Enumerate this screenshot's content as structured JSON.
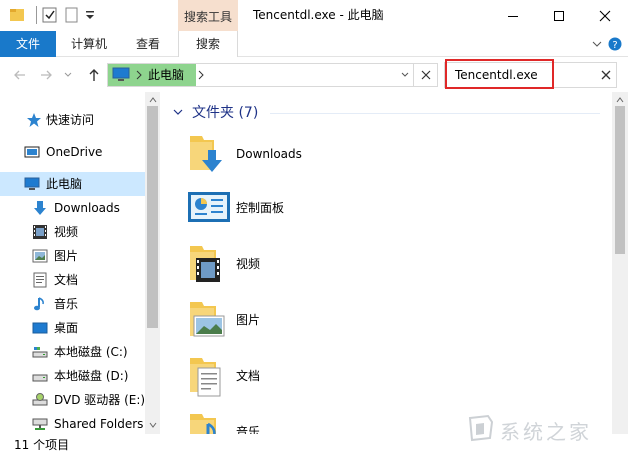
{
  "titlebar": {
    "context_tab": "搜索工具",
    "title": "Tencentdl.exe - 此电脑"
  },
  "ribbon": {
    "file_tab": "文件",
    "tabs": [
      "计算机",
      "查看",
      "搜索"
    ]
  },
  "address": {
    "location": "此电脑",
    "search_value": "Tencentdl.exe"
  },
  "sidebar": {
    "items": [
      {
        "label": "快速访问",
        "icon": "star-icon"
      },
      {
        "label": "OneDrive",
        "icon": "cloud-icon"
      },
      {
        "label": "此电脑",
        "icon": "computer-icon",
        "selected": true
      },
      {
        "label": "Downloads",
        "icon": "download-arrow-icon"
      },
      {
        "label": "视频",
        "icon": "video-icon"
      },
      {
        "label": "图片",
        "icon": "picture-icon"
      },
      {
        "label": "文档",
        "icon": "document-icon"
      },
      {
        "label": "音乐",
        "icon": "music-note-icon"
      },
      {
        "label": "桌面",
        "icon": "desktop-icon"
      },
      {
        "label": "本地磁盘 (C:)",
        "icon": "drive-icon"
      },
      {
        "label": "本地磁盘 (D:)",
        "icon": "drive-icon"
      },
      {
        "label": "DVD 驱动器 (E:)",
        "icon": "dvd-drive-icon"
      },
      {
        "label": "Shared Folders",
        "icon": "network-drive-icon"
      }
    ]
  },
  "content": {
    "group_header": "文件夹 (7)",
    "items": [
      {
        "label": "Downloads",
        "icon": "downloads-folder-icon"
      },
      {
        "label": "控制面板",
        "icon": "control-panel-icon"
      },
      {
        "label": "视频",
        "icon": "videos-folder-icon"
      },
      {
        "label": "图片",
        "icon": "pictures-folder-icon"
      },
      {
        "label": "文档",
        "icon": "documents-folder-icon"
      },
      {
        "label": "音乐",
        "icon": "music-folder-icon"
      }
    ]
  },
  "status": {
    "count": "11 个项目"
  },
  "watermark": {
    "text": "系统之家"
  },
  "colors": {
    "accent": "#1979ca",
    "selected": "#cce8ff",
    "context_tab": "#f6dfce",
    "highlight_box": "#e02828",
    "address_green": "#8ed48e",
    "group_header": "#1e3287",
    "folder": "#f3c750"
  }
}
